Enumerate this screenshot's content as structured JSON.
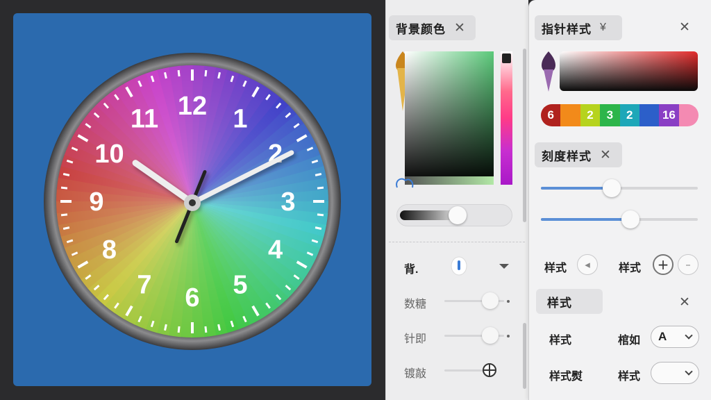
{
  "clock": {
    "numerals": [
      "12",
      "1",
      "2",
      "3",
      "4",
      "5",
      "6",
      "7",
      "8",
      "9",
      "10",
      "11"
    ],
    "time": {
      "hour": 10,
      "minute": 10,
      "second": 32
    },
    "background": "#2b6aae"
  },
  "left_panel": {
    "title": "背景颜色",
    "close_icon": "✕",
    "rows": [
      {
        "label": "背."
      },
      {
        "label": "数糖"
      },
      {
        "label": "针即"
      },
      {
        "label": "镀敲"
      }
    ]
  },
  "right_panel": {
    "hand_style": {
      "title": "指针样式",
      "pin_icon": "¥",
      "close_icon": "✕"
    },
    "rainbow_labels": [
      "6",
      "",
      "2",
      "3",
      "2",
      "",
      "16",
      ""
    ],
    "tick_style": {
      "title": "刻度样式",
      "close_icon": "✕"
    },
    "sliders": [
      {
        "value": 0.45
      },
      {
        "value": 0.57
      }
    ],
    "style_row": {
      "label_a": "样式",
      "label_b": "样式"
    },
    "style_section": {
      "title": "样式",
      "close_icon": "✕"
    },
    "row1": {
      "label": "样式",
      "label2": "棺如",
      "select_value": "A"
    },
    "row2": {
      "label": "样式熨",
      "label2": "样式",
      "select_value": ""
    }
  },
  "colors": {
    "accent_blue": "#5b8fd6",
    "canvas_blue": "#2b6aae"
  }
}
